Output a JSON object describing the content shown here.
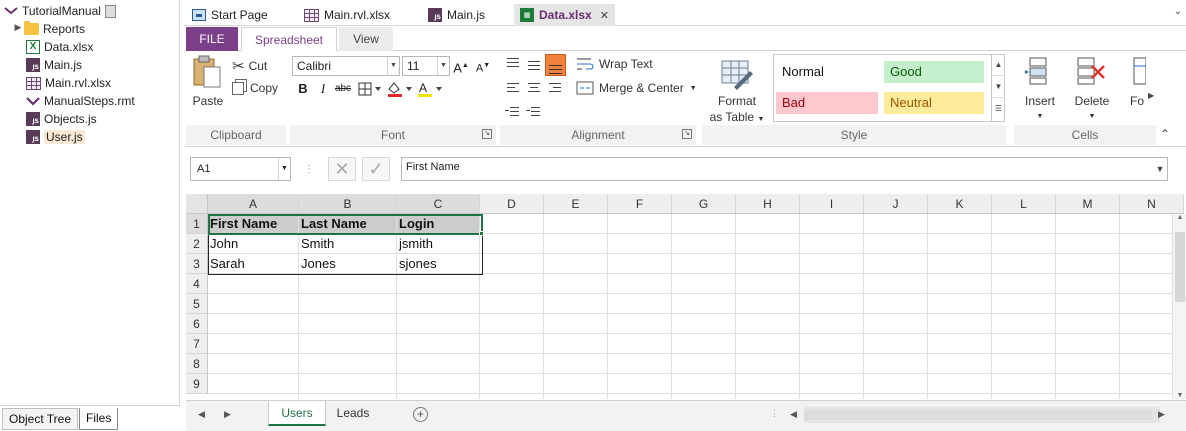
{
  "sidebar": {
    "root": "TutorialManual",
    "items": [
      {
        "label": "Reports",
        "icon": "folder-icon"
      },
      {
        "label": "Data.xlsx",
        "icon": "excel-file-icon"
      },
      {
        "label": "Main.js",
        "icon": "js-file-icon"
      },
      {
        "label": "Main.rvl.xlsx",
        "icon": "rvl-grid-icon"
      },
      {
        "label": "ManualSteps.rmt",
        "icon": "manual-steps-icon"
      },
      {
        "label": "Objects.js",
        "icon": "js-file-icon"
      },
      {
        "label": "User.js",
        "icon": "js-file-icon"
      }
    ],
    "tabs": [
      "Object Tree",
      "Files"
    ]
  },
  "doc_tabs": [
    {
      "label": "Start Page"
    },
    {
      "label": "Main.rvl.xlsx"
    },
    {
      "label": "Main.js"
    },
    {
      "label": "Data.xlsx",
      "active": true
    }
  ],
  "ribbon": {
    "tabs": [
      "FILE",
      "Spreadsheet",
      "View"
    ],
    "clipboard": {
      "paste": "Paste",
      "cut": "Cut",
      "copy": "Copy",
      "label": "Clipboard"
    },
    "font": {
      "name": "Calibri",
      "size": "11",
      "label": "Font",
      "bold": "B",
      "italic": "I",
      "strike": "abc"
    },
    "alignment": {
      "wrap": "Wrap Text",
      "merge": "Merge & Center",
      "label": "Alignment"
    },
    "style": {
      "format_line1": "Format",
      "format_line2": "as Table",
      "normal": "Normal",
      "good": "Good",
      "bad": "Bad",
      "neutral": "Neutral",
      "label": "Style"
    },
    "cells": {
      "insert": "Insert",
      "delete": "Delete",
      "format": "Fo",
      "label": "Cells"
    }
  },
  "formula_bar": {
    "name_box": "A1",
    "value": "First Name"
  },
  "grid": {
    "columns": [
      "A",
      "B",
      "C",
      "D",
      "E",
      "F",
      "G",
      "H",
      "I",
      "J",
      "K",
      "L",
      "M",
      "N"
    ],
    "rows": [
      "1",
      "2",
      "3",
      "4",
      "5",
      "6",
      "7",
      "8",
      "9"
    ],
    "data": [
      [
        "First Name",
        "Last Name",
        "Login"
      ],
      [
        "John",
        "Smith",
        "jsmith"
      ],
      [
        "Sarah",
        "Jones",
        "sjones"
      ]
    ]
  },
  "sheets": [
    "Users",
    "Leads"
  ],
  "colors": {
    "accent": "#7b3f8a",
    "excel_green": "#217346",
    "good_bg": "#c6efce",
    "good_fg": "#006100",
    "bad_bg": "#ffc7ce",
    "bad_fg": "#9c0006",
    "neutral_bg": "#ffeb9c",
    "neutral_fg": "#9c5700"
  }
}
